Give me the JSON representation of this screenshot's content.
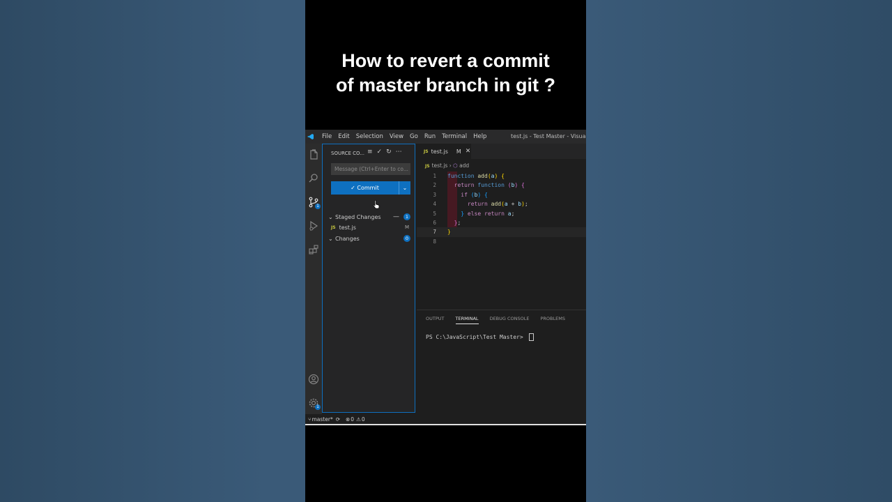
{
  "video_title": {
    "line1": "How to revert a commit",
    "line2": "of master branch in git ?"
  },
  "menubar": {
    "items": [
      "File",
      "Edit",
      "Selection",
      "View",
      "Go",
      "Run",
      "Terminal",
      "Help"
    ],
    "window_title": "test.js - Test Master - Visual Stu"
  },
  "sidebar": {
    "header": "SOURCE CO...",
    "message_placeholder": "Message (Ctrl+Enter to co...",
    "commit_label": "✓ Commit",
    "commit_dropdown": "⌄",
    "staged": {
      "label": "Staged Changes",
      "count": "1",
      "files": [
        {
          "name": "test.js",
          "status": "M",
          "icon": "JS"
        }
      ]
    },
    "changes": {
      "label": "Changes",
      "count": "0"
    }
  },
  "editor": {
    "tab": {
      "name": "test.js",
      "status": "M",
      "icon": "JS"
    },
    "breadcrumb": {
      "file": "test.js",
      "symbol": "add"
    },
    "line_numbers": [
      "1",
      "2",
      "3",
      "4",
      "5",
      "6",
      "7",
      "8"
    ]
  },
  "panel": {
    "tabs": [
      "OUTPUT",
      "TERMINAL",
      "DEBUG CONSOLE",
      "PROBLEMS"
    ],
    "active_tab": "TERMINAL",
    "prompt": "PS C:\\JavaScript\\Test Master> "
  },
  "statusbar": {
    "branch": "master*",
    "errors": "0",
    "warnings": "0"
  },
  "colors": {
    "accent": "#0e70c0",
    "background": "#1e1e1e",
    "sidebar_bg": "#252526"
  }
}
